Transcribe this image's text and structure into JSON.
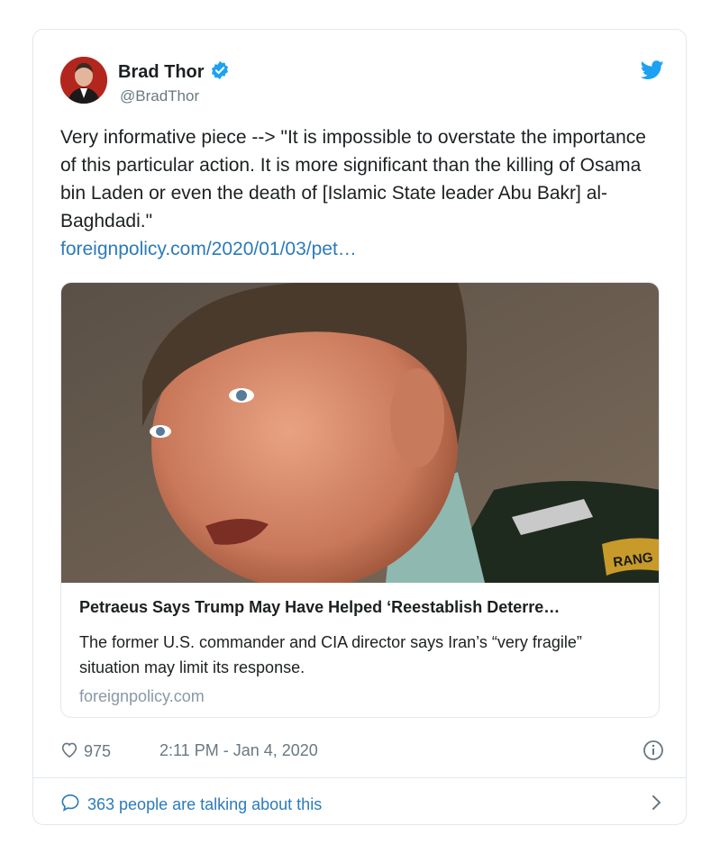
{
  "author": {
    "name": "Brad Thor",
    "handle": "@BradThor",
    "verified": true
  },
  "tweet": {
    "text": "Very informative piece --> \"It is impossible to overstate the importance of this particular action. It is more significant than the killing of Osama bin Laden or even the death of [Islamic State leader Abu Bakr] al-Baghdadi.\"",
    "link": "foreignpolicy.com/2020/01/03/pet…"
  },
  "link_card": {
    "image_badge": "RANG",
    "title": "Petraeus Says Trump May Have Helped ‘Reestablish Deterre…",
    "description": "The former U.S. commander and CIA director says Iran’s “very fragile” situation may limit its response.",
    "domain": "foreignpolicy.com"
  },
  "meta": {
    "likes": "975",
    "timestamp": "2:11 PM - Jan 4, 2020"
  },
  "footer": {
    "talking": "363 people are talking about this"
  },
  "colors": {
    "link_blue": "#2b7bb9",
    "twitter_blue": "#1da1f2",
    "muted_gray": "#697882",
    "border": "#e1e8ed"
  },
  "icons": [
    "verified-badge-icon",
    "twitter-bird-icon",
    "heart-icon",
    "info-icon",
    "speech-bubble-icon",
    "chevron-right-icon"
  ]
}
